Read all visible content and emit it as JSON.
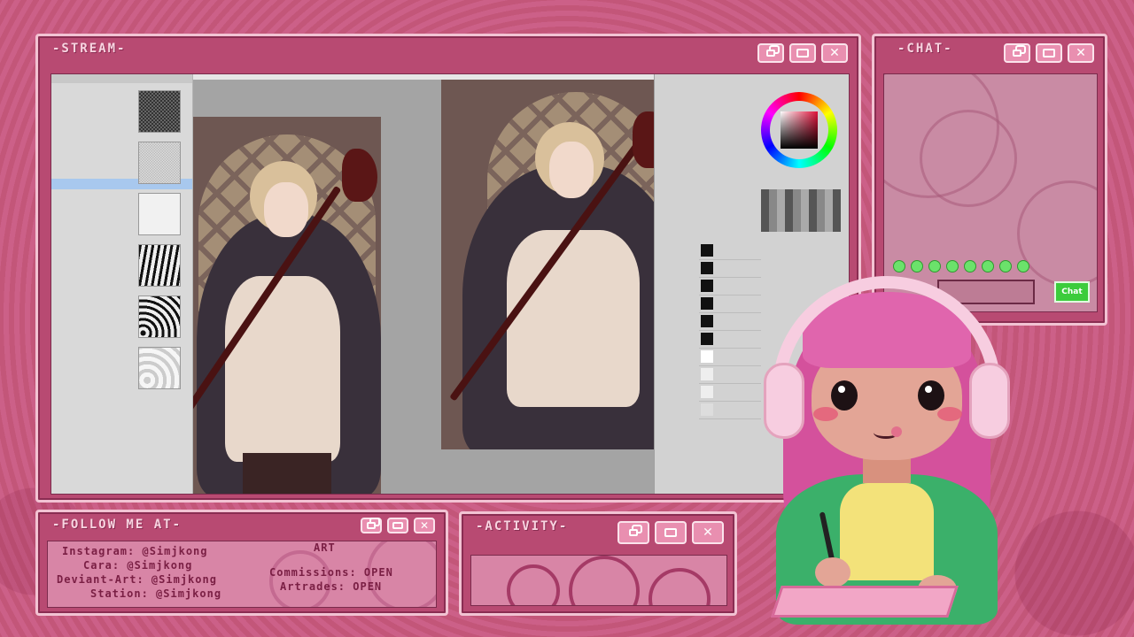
{
  "stream": {
    "title": "-STREAM-"
  },
  "chat": {
    "title": "-CHAT-",
    "send_label": "Chat"
  },
  "follow": {
    "title": "-FOLLOW ME AT-",
    "lines": [
      "Instagram: @Simjkong",
      "Cara: @Simjkong",
      "Deviant-Art: @Simjkong",
      "Station: @Simjkong"
    ],
    "art_heading": "ART",
    "commissions": "Commissions: OPEN",
    "artrades": "Artrades: OPEN"
  },
  "activity": {
    "title": "-ACTIVITY-"
  },
  "colors": {
    "frame": "#b84a72",
    "border": "#f2c3d3",
    "accent": "#3ccc3c",
    "hair": "#e065ad",
    "jacket": "#3bb06a"
  },
  "icons": [
    "restore-icon",
    "maximize-icon",
    "close-icon"
  ]
}
